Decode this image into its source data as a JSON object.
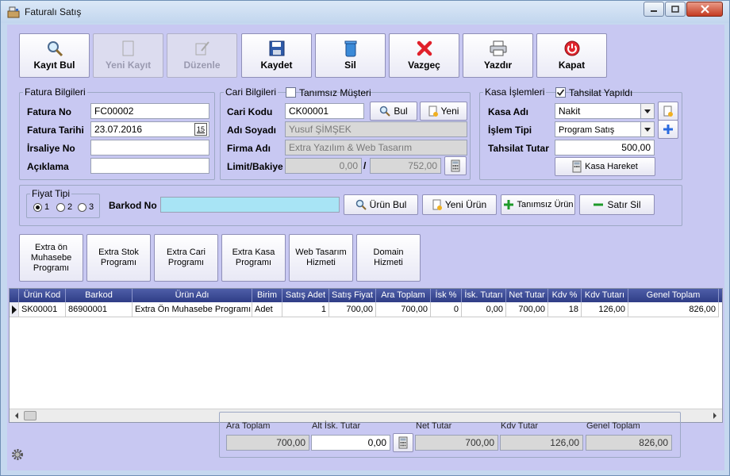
{
  "window": {
    "title": "Faturalı Satış"
  },
  "toolbar": {
    "buttons": [
      {
        "label": "Kayıt Bul"
      },
      {
        "label": "Yeni Kayıt"
      },
      {
        "label": "Düzenle"
      },
      {
        "label": "Kaydet"
      },
      {
        "label": "Sil"
      },
      {
        "label": "Vazgeç"
      },
      {
        "label": "Yazdır"
      },
      {
        "label": "Kapat"
      }
    ]
  },
  "fatura": {
    "legend": "Fatura Bilgileri",
    "no_label": "Fatura No",
    "no_value": "FC00002",
    "tarih_label": "Fatura Tarihi",
    "tarih_value": "23.07.2016",
    "tarih_btn": "15",
    "irsaliye_label": "İrsaliye No",
    "irsaliye_value": "",
    "aciklama_label": "Açıklama",
    "aciklama_value": ""
  },
  "cari": {
    "legend": "Cari Bilgileri",
    "tanimsiz_label": "Tanımsız Müşteri",
    "kod_label": "Cari Kodu",
    "kod_value": "CK00001",
    "bul_label": "Bul",
    "yeni_label": "Yeni",
    "adsoyad_label": "Adı Soyadı",
    "adsoyad_value": "Yusuf ŞİMŞEK",
    "firma_label": "Firma Adı",
    "firma_value": "Extra Yazılım & Web Tasarım",
    "limit_label": "Limit/Bakiye",
    "limit_value": "0,00",
    "sep": "/",
    "bakiye_value": "752,00"
  },
  "kasa": {
    "legend": "Kasa İşlemleri",
    "tahsilat_yapildi_label": "Tahsilat Yapıldı",
    "ad_label": "Kasa Adı",
    "ad_value": "Nakit",
    "islem_label": "İşlem Tipi",
    "islem_value": "Program Satış",
    "tutar_label": "Tahsilat Tutar",
    "tutar_value": "500,00",
    "hareket_label": "Kasa Hareket"
  },
  "barkod": {
    "fiyat_legend": "Fiyat Tipi",
    "fiyat_options": [
      "1",
      "2",
      "3"
    ],
    "label": "Barkod No",
    "value": "",
    "urun_bul": "Ürün Bul",
    "yeni_urun": "Yeni Ürün",
    "tanimsiz_urun": "Tanımsız Ürün",
    "satir_sil": "Satır Sil"
  },
  "quick": [
    "Extra ön Muhasebe Programı",
    "Extra Stok Programı",
    "Extra Cari Programı",
    "Extra Kasa Programı",
    "Web Tasarım Hizmeti",
    "Domain Hizmeti"
  ],
  "grid": {
    "columns": [
      "Ürün Kod",
      "Barkod",
      "Ürün Adı",
      "Birim",
      "Satış Adet",
      "Satış Fiyat",
      "Ara Toplam",
      "İsk %",
      "İsk. Tutarı",
      "Net Tutar",
      "Kdv %",
      "Kdv Tutarı",
      "Genel Toplam"
    ],
    "rows": [
      [
        "SK00001",
        "86900001",
        "Extra Ön Muhasebe Programı",
        "Adet",
        "1",
        "700,00",
        "700,00",
        "0",
        "0,00",
        "700,00",
        "18",
        "126,00",
        "826,00"
      ]
    ]
  },
  "totals": {
    "ara_label": "Ara Toplam",
    "ara_value": "700,00",
    "altisk_label": "Alt İsk. Tutar",
    "altisk_value": "0,00",
    "net_label": "Net Tutar",
    "net_value": "700,00",
    "kdv_label": "Kdv Tutar",
    "kdv_value": "126,00",
    "genel_label": "Genel Toplam",
    "genel_value": "826,00"
  },
  "colors": {
    "client_bg": "#c8c8f2",
    "grid_header": "#34428b",
    "barcode_field": "#a8e4f5"
  }
}
